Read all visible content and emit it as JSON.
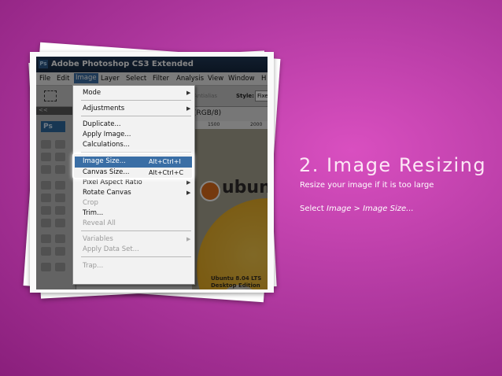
{
  "slide": {
    "heading": "2. Image Resizing",
    "line1": "Resize your image if it is too large",
    "line2_prefix": "Select ",
    "line2_menu": "Image",
    "line2_sep": " > ",
    "line2_item": "Image Size...",
    "background_color": "#b33aa2"
  },
  "app": {
    "title": "Adobe Photoshop CS3 Extended",
    "logo_text": "Ps",
    "menubar": [
      "File",
      "Edit",
      "Image",
      "Layer",
      "Select",
      "Filter",
      "Analysis",
      "View",
      "Window",
      "H"
    ],
    "active_menu": "Image"
  },
  "options_bar": {
    "antialias": "Antialias",
    "style_label": "Style:",
    "style_value": "Fixe"
  },
  "toolbox": {
    "collapse": "<<",
    "logo": "Ps"
  },
  "document": {
    "tab_fragment": "(RGB/8)",
    "ruler": [
      "1500",
      "2000"
    ],
    "ubuntu_word": "ubun",
    "disc_text_1": "Ubuntu 8.04 LTS",
    "disc_text_2": "Desktop Edition (6"
  },
  "image_menu": {
    "items": [
      {
        "label": "Mode",
        "submenu": true,
        "disabled": false
      },
      {
        "label": "Adjustments",
        "submenu": true,
        "disabled": false
      },
      {
        "label": "Duplicate...",
        "disabled": false
      },
      {
        "label": "Apply Image...",
        "disabled": false
      },
      {
        "label": "Calculations...",
        "disabled": false
      },
      {
        "label": "Image Size...",
        "shortcut": "Alt+Ctrl+I",
        "disabled": false,
        "highlighted": true
      },
      {
        "label": "Canvas Size...",
        "shortcut": "Alt+Ctrl+C",
        "disabled": false
      },
      {
        "label": "Pixel Aspect Ratio",
        "submenu": true,
        "disabled": false
      },
      {
        "label": "Rotate Canvas",
        "submenu": true,
        "disabled": false
      },
      {
        "label": "Crop",
        "disabled": true
      },
      {
        "label": "Trim...",
        "disabled": false
      },
      {
        "label": "Reveal All",
        "disabled": true
      },
      {
        "label": "Variables",
        "submenu": true,
        "disabled": true
      },
      {
        "label": "Apply Data Set...",
        "disabled": true
      },
      {
        "label": "Trap...",
        "disabled": true
      }
    ],
    "highlight_color": "#3a6ea5"
  }
}
